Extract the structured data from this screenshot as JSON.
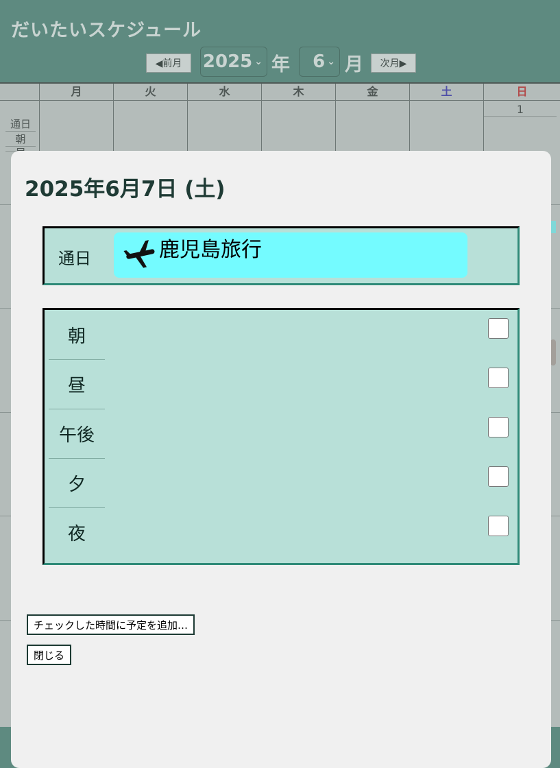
{
  "app": {
    "title": "だいたいスケジュール",
    "prev_month_label": "◀前月",
    "next_month_label": "次月▶",
    "year_value": "2025",
    "year_unit": "年",
    "month_value": "6",
    "month_unit": "月",
    "chevron": "⌄"
  },
  "calendar": {
    "weekdays": [
      "月",
      "火",
      "水",
      "木",
      "金",
      "土",
      "日"
    ],
    "weekday_colors": [
      "#4f5755",
      "#4f5755",
      "#4f5755",
      "#4f5755",
      "#4f5755",
      "#4f4fa8",
      "#b24a4a"
    ],
    "first_day_number": "1",
    "row_labels": [
      "通日",
      "朝",
      "昼"
    ]
  },
  "modal": {
    "title": "2025年6月7日 (土)",
    "allday_label": "通日",
    "event": {
      "icon": "airplane-icon",
      "title": "鹿児島旅行",
      "color": "#74fbff"
    },
    "slots": [
      {
        "label": "朝",
        "checked": false
      },
      {
        "label": "昼",
        "checked": false
      },
      {
        "label": "午後",
        "checked": false
      },
      {
        "label": "夕",
        "checked": false
      },
      {
        "label": "夜",
        "checked": false
      }
    ],
    "add_button_label": "チェックした時間に予定を追加…",
    "close_button_label": "閉じる"
  }
}
